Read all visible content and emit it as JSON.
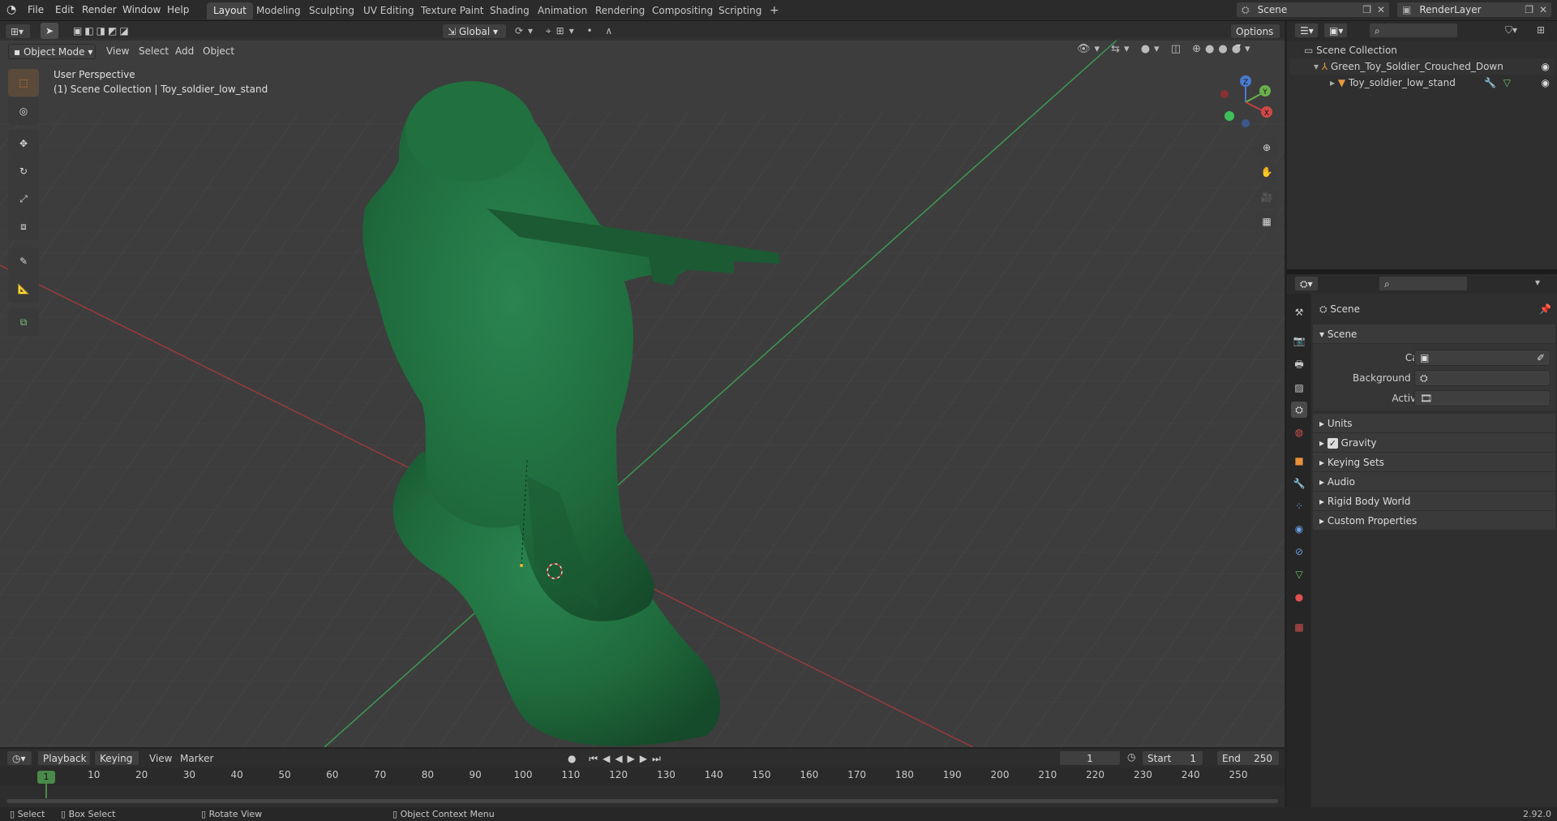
{
  "topbar": {
    "menus": [
      "File",
      "Edit",
      "Render",
      "Window",
      "Help"
    ],
    "workspaces": [
      "Layout",
      "Modeling",
      "Sculpting",
      "UV Editing",
      "Texture Paint",
      "Shading",
      "Animation",
      "Rendering",
      "Compositing",
      "Scripting"
    ],
    "add_tab": "+",
    "scene_name": "Scene",
    "view_layer": "RenderLayer"
  },
  "viewport": {
    "mode": "Object Mode",
    "menus": [
      "View",
      "Select",
      "Add",
      "Object"
    ],
    "orientation": "Global",
    "options": "Options",
    "perspective_label": "User Perspective",
    "collection_label": "(1) Scene Collection | Toy_soldier_low_stand",
    "gizmo": {
      "x": "X",
      "y": "Y",
      "z": "Z"
    },
    "model_color": "#1f6a3c"
  },
  "outliner": {
    "root": "Scene Collection",
    "items": [
      {
        "label": "Green_Toy_Soldier_Crouched_Down"
      },
      {
        "label": "Toy_soldier_low_stand"
      }
    ]
  },
  "properties": {
    "header": "Scene",
    "section": "Scene",
    "fields": [
      {
        "label": "Camera",
        "value": ""
      },
      {
        "label": "Background Scene",
        "value": ""
      },
      {
        "label": "Active Clip",
        "value": ""
      }
    ],
    "subsections": [
      "Units",
      "Gravity",
      "Keying Sets",
      "Audio",
      "Rigid Body World",
      "Custom Properties"
    ],
    "gravity_checked": true
  },
  "timeline": {
    "menus": [
      "Playback",
      "Keying",
      "View",
      "Marker"
    ],
    "current_frame": "1",
    "start_label": "Start",
    "start": "1",
    "end_label": "End",
    "end": "250",
    "ticks": [
      "1",
      "10",
      "20",
      "30",
      "40",
      "50",
      "60",
      "70",
      "80",
      "90",
      "100",
      "110",
      "120",
      "130",
      "140",
      "150",
      "160",
      "170",
      "180",
      "190",
      "200",
      "210",
      "220",
      "230",
      "240",
      "250"
    ]
  },
  "statusbar": {
    "select": "Select",
    "box_select": "Box Select",
    "rotate": "Rotate View",
    "context_menu": "Object Context Menu",
    "version": "2.92.0"
  }
}
